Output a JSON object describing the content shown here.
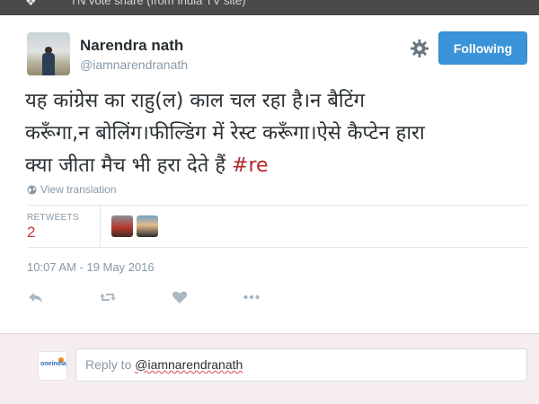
{
  "header": {
    "caption": "TN vote share (from India TV site)"
  },
  "tweet": {
    "author_name": "Narendra nath",
    "author_handle": "@iamnarendranath",
    "follow_label": "Following",
    "text_line1": "यह कांग्रेस का राहु(ल) काल चल रहा है।न बैटिंग",
    "text_line2": "करूँगा,न बोलिंग।फील्डिंग में रेस्ट करूँगा।ऐसे कैप्टेन हारा",
    "text_line3_prefix": "क्या जीता मैच भी हरा देते हैं ",
    "hashtag": "#re",
    "view_translation_label": "View translation",
    "retweets_label": "RETWEETS",
    "retweets_count": "2",
    "timestamp": "10:07 AM - 19 May 2016"
  },
  "reply": {
    "logo_text": "oneindia",
    "prefix": "Reply to ",
    "mention": "@iamnarendranath"
  },
  "icons": {
    "header": "bird-icon",
    "settings": "gear-icon",
    "translation": "globe-icon",
    "actions": [
      "reply-icon",
      "retweet-icon",
      "like-icon",
      "more-icon"
    ]
  },
  "colors": {
    "follow_button": "#3b94d9",
    "hashtag": "#b22525",
    "retweet_count": "#c23a3a",
    "reply_background": "#f6eeee"
  }
}
